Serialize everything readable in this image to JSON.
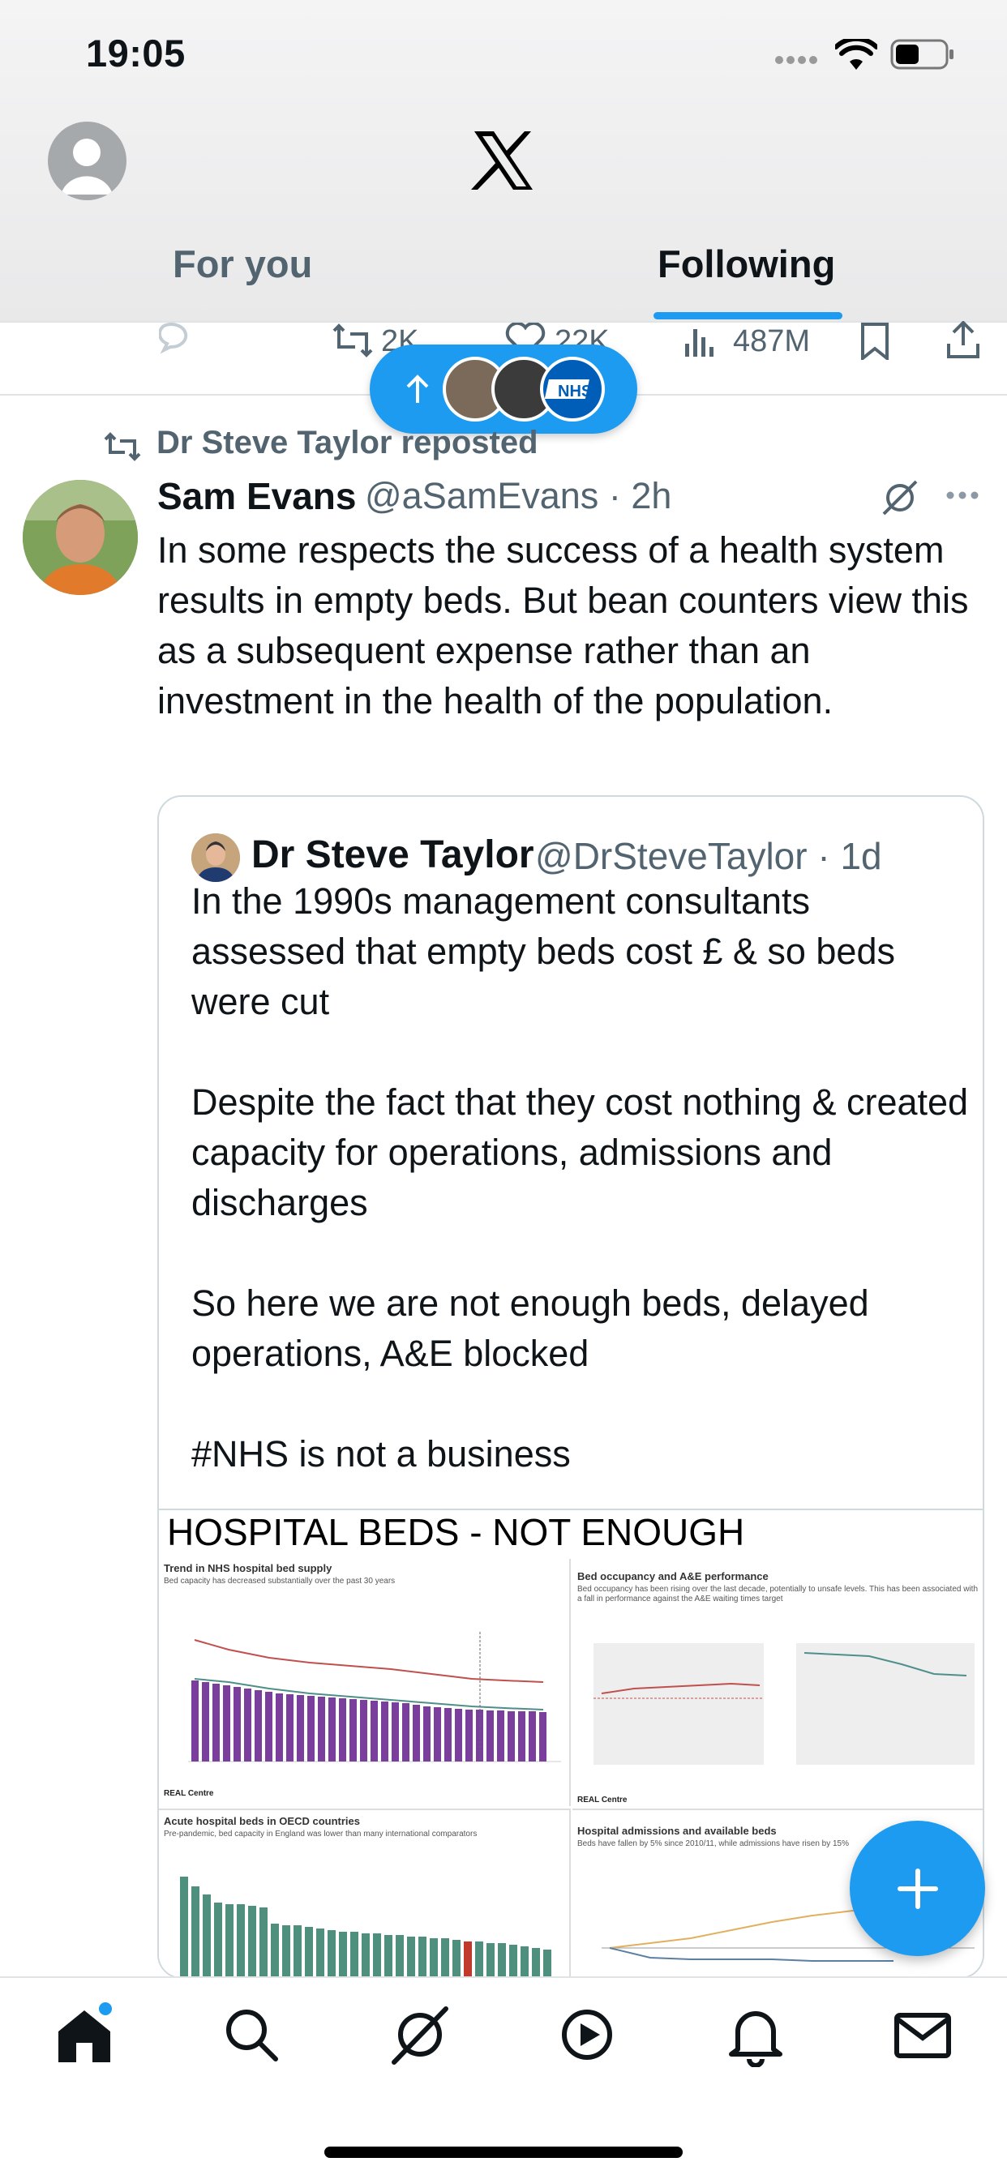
{
  "status_bar": {
    "time": "19:05"
  },
  "header": {
    "tabs": [
      {
        "label": "For you",
        "active": false
      },
      {
        "label": "Following",
        "active": true
      }
    ]
  },
  "prev_tweet_actions": {
    "reposts": "2K",
    "likes": "22K",
    "views": "487M"
  },
  "tweet": {
    "reposted_by": "Dr Steve Taylor reposted",
    "author_name": "Sam Evans",
    "author_handle": "@aSamEvans",
    "time": "2h",
    "text": "In some respects the success of a health system results in empty beds. But bean counters view this as a subsequent expense rather than an investment in the health of the population.",
    "quote": {
      "author_name": "Dr Steve Taylor",
      "author_handle": "@DrSteveTaylor",
      "time": "1d",
      "text": "In the 1990s management consultants assessed that empty beds cost £ & so beds were cut\n\nDespite the fact that they cost nothing & created capacity for operations, admissions and discharges\n\nSo here we are not enough beds, delayed operations, A&E blocked\n\n#NHS is not a business",
      "image": {
        "title": "HOSPITAL BEDS - NOT ENOUGH",
        "panels": [
          {
            "title": "Trend in NHS hospital bed supply",
            "subtitle": "Bed capacity has decreased substantially over the past 30 years",
            "footer": "REAL Centre"
          },
          {
            "title": "Bed occupancy and A&E performance",
            "subtitle": "Bed occupancy has been rising over the last decade, potentially to unsafe levels. This has been associated with a fall in performance against the A&E waiting times target",
            "footer": "REAL Centre"
          },
          {
            "title": "Acute hospital beds in OECD countries",
            "subtitle": "Pre-pandemic, bed capacity in England was lower than many international comparators",
            "footer": ""
          },
          {
            "title": "Hospital admissions and available beds",
            "subtitle": "Beds have fallen by 5% since 2010/11, while admissions have risen by 15%",
            "footer": ""
          }
        ]
      }
    }
  },
  "colors": {
    "accent": "#1d9bf0",
    "text": "#0f1419",
    "secondary": "#536471",
    "border": "#cfd9de"
  },
  "nav": {
    "items": [
      "home-icon",
      "search-icon",
      "grok-icon",
      "play-icon",
      "bell-icon",
      "mail-icon"
    ]
  }
}
